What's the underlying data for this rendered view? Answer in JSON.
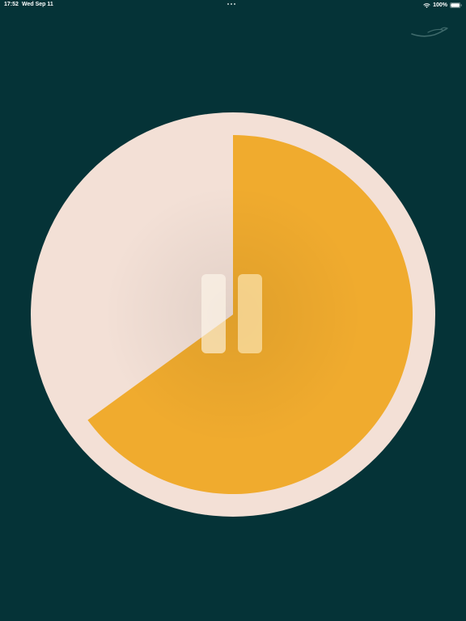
{
  "status_bar": {
    "time": "17:52",
    "date": "Wed Sep 11",
    "battery_percent": "100%",
    "icons": [
      "wifi-icon",
      "battery-icon"
    ]
  },
  "timer": {
    "remaining_fraction": 0.65,
    "colors": {
      "background": "#053337",
      "dial_face": "#f3e0d6",
      "remaining_wedge": "#f0ab2e"
    }
  },
  "controls": {
    "pause_icon": "pause-icon"
  },
  "decor": {
    "icon": "feather-swoosh-icon"
  }
}
